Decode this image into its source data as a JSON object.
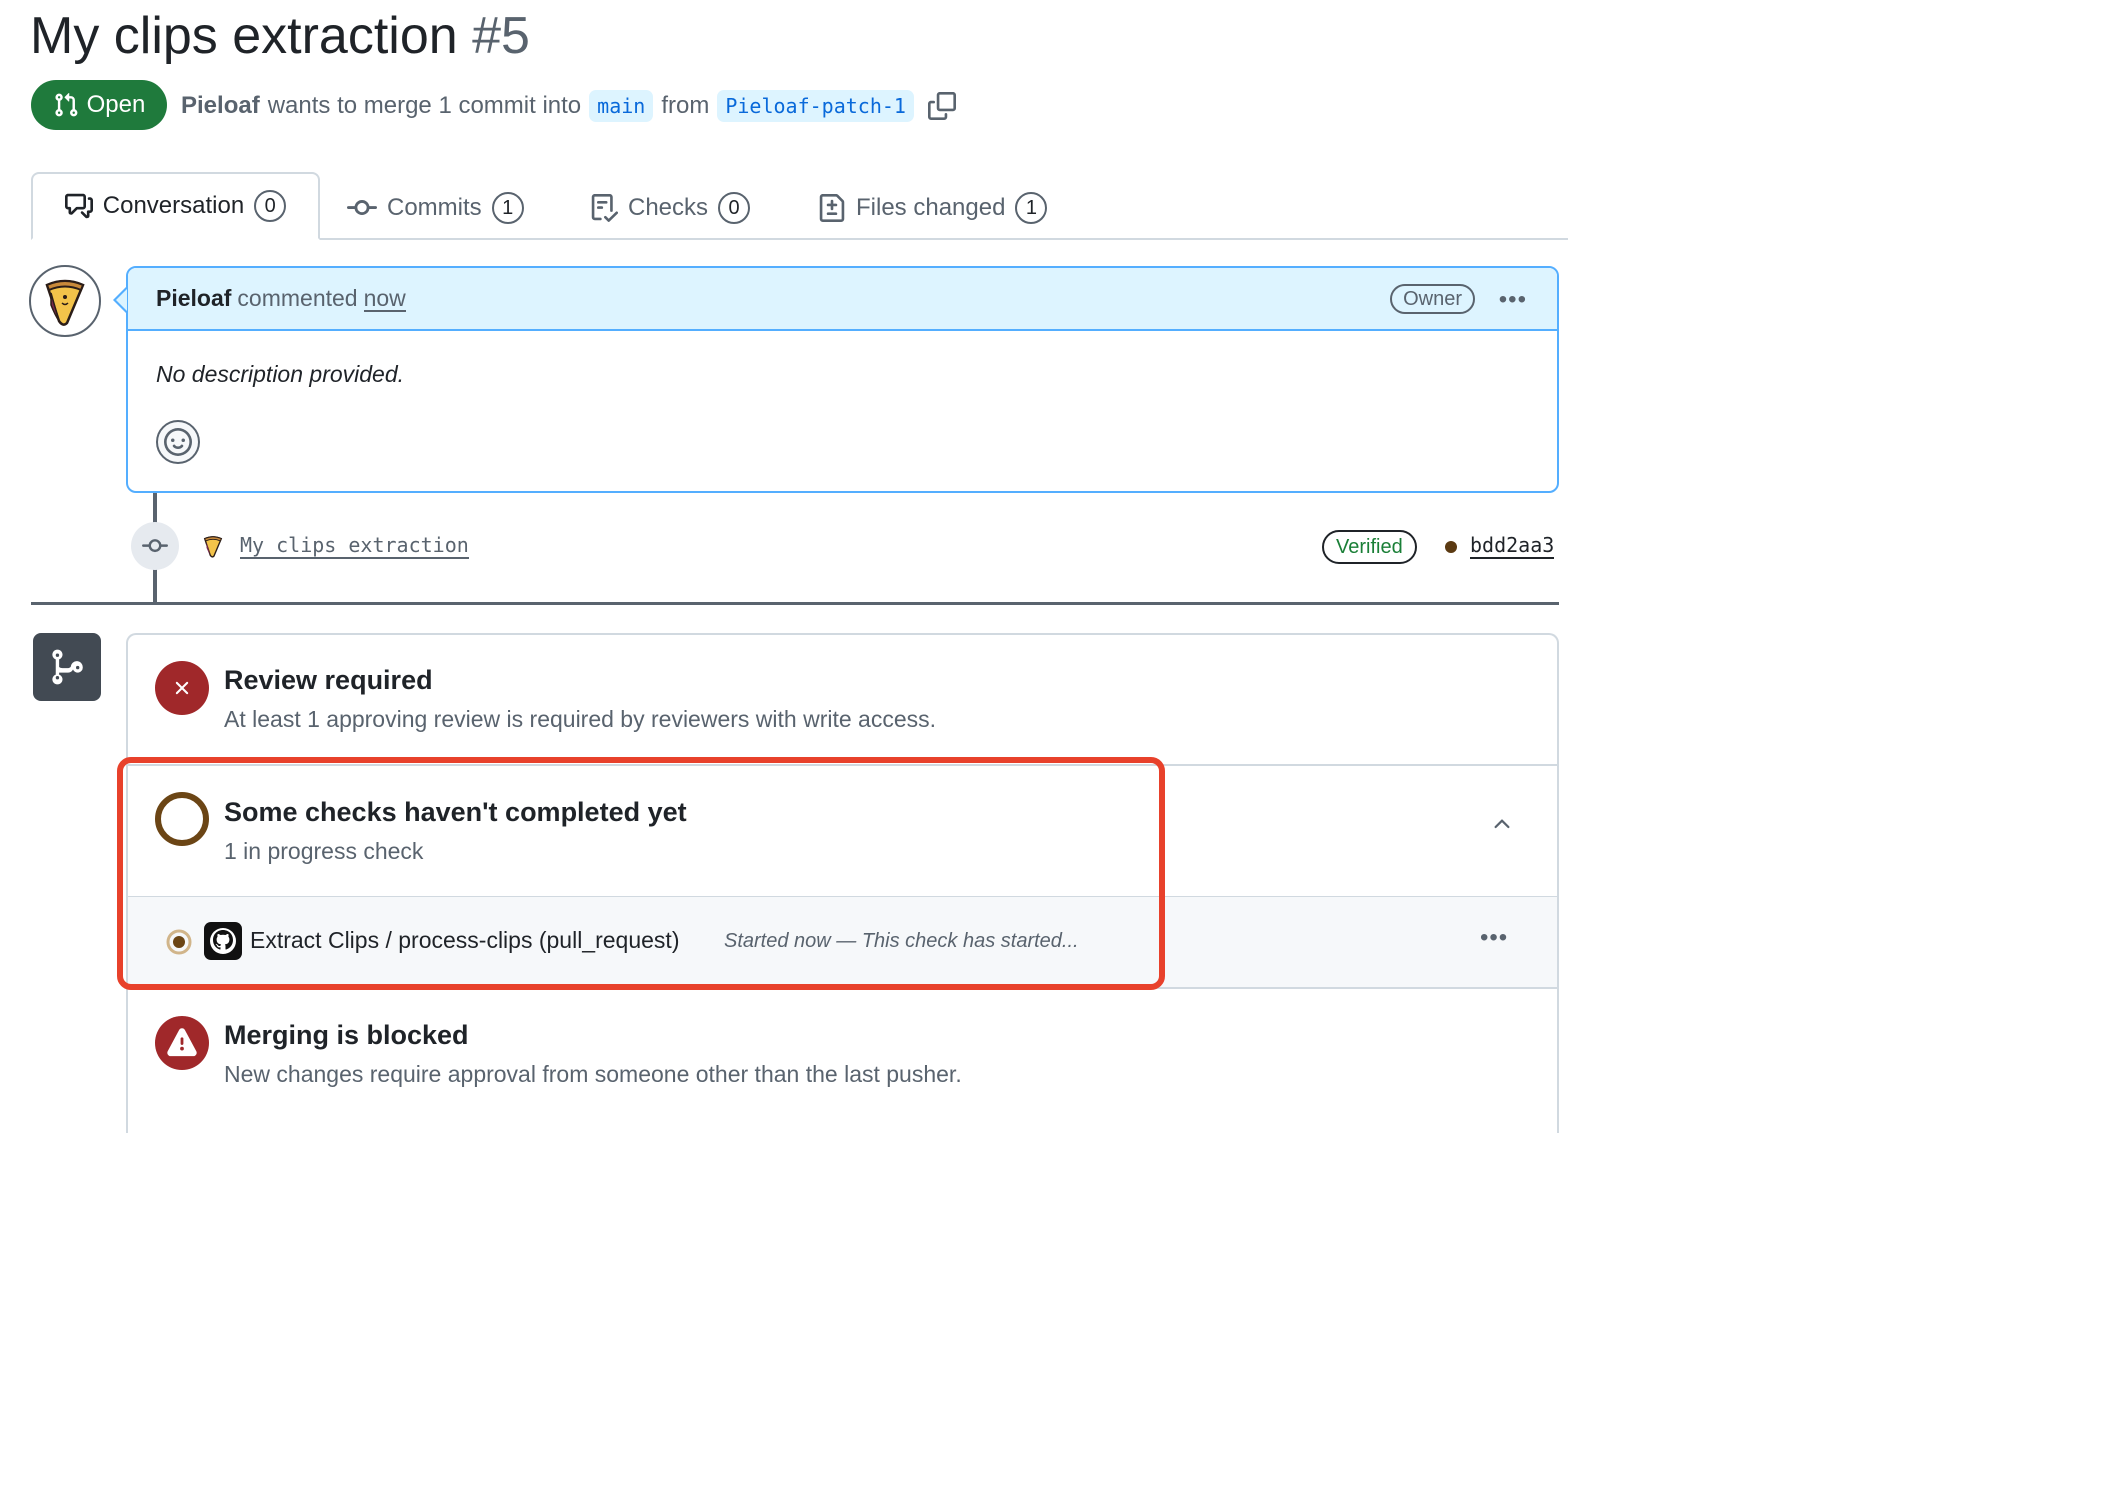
{
  "pr": {
    "title": "My clips extraction",
    "number": "#5",
    "state": "Open",
    "author": "Pieloaf",
    "merge_text": "wants to merge 1 commit into",
    "base_branch": "main",
    "from_text": "from",
    "head_branch": "Pieloaf-patch-1"
  },
  "tabs": [
    {
      "label": "Conversation",
      "count": "0",
      "icon": "comment-discussion-icon",
      "active": true
    },
    {
      "label": "Commits",
      "count": "1",
      "icon": "git-commit-icon"
    },
    {
      "label": "Checks",
      "count": "0",
      "icon": "checklist-icon"
    },
    {
      "label": "Files changed",
      "count": "1",
      "icon": "file-diff-icon"
    }
  ],
  "comment": {
    "author": "Pieloaf",
    "action": "commented",
    "time": "now",
    "role_badge": "Owner",
    "body": "No description provided."
  },
  "commit": {
    "message": "My clips extraction",
    "verified_label": "Verified",
    "sha": "bdd2aa3"
  },
  "merge_status": {
    "review": {
      "title": "Review required",
      "subtitle": "At least 1 approving review is required by reviewers with write access."
    },
    "checks": {
      "title": "Some checks haven't completed yet",
      "subtitle": "1 in progress check",
      "items": [
        {
          "name": "Extract Clips / process-clips (pull_request)",
          "status": "Started now — This check has started..."
        }
      ]
    },
    "blocked": {
      "title": "Merging is blocked",
      "subtitle": "New changes require approval from someone other than the last pusher."
    }
  },
  "colors": {
    "open_green": "#1f7a3c",
    "error_red": "#a0282a",
    "pending_brown": "#6b4515",
    "highlight": "#e8412b",
    "link_blue": "#0969da"
  }
}
